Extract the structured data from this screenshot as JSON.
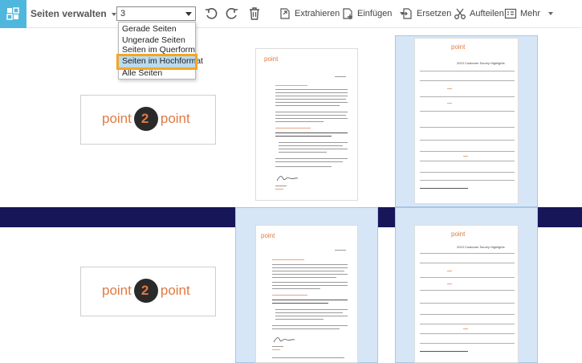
{
  "toolbar": {
    "title": "Seiten verwalten",
    "range_value": "3",
    "actions": {
      "extract": "Extrahieren",
      "insert": "Einfügen",
      "replace": "Ersetzen",
      "split": "Aufteilen",
      "more": "Mehr"
    }
  },
  "dropdown": {
    "options": [
      "Gerade Seiten",
      "Ungerade Seiten",
      "Seiten im Querformat",
      "Seiten im Hochformat",
      "Alle Seiten"
    ],
    "highlighted": "Seiten im Hochformat"
  },
  "thumbnails": {
    "logo_text_left": "point",
    "logo_text_right": "point",
    "survey_title": "2013 Customer Survey Highlights"
  },
  "colors": {
    "accent": "#4fb7de",
    "highlight_border": "#f5a623",
    "selection": "#d7e6f6",
    "divider": "#161659",
    "logo_orange": "#e07a43"
  }
}
